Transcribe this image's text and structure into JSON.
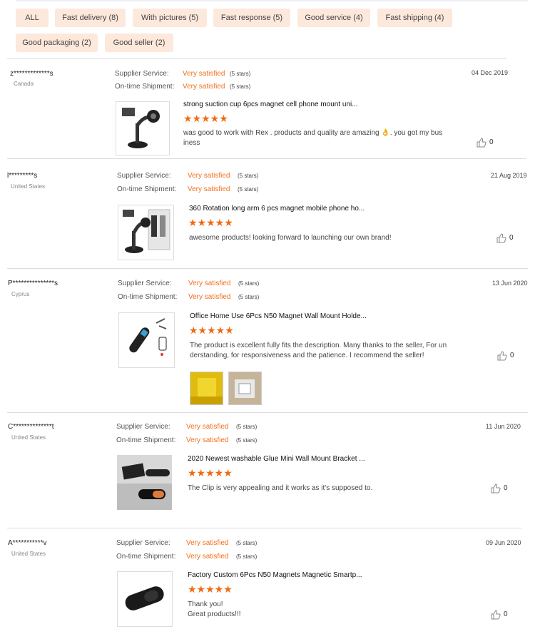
{
  "filters": [
    {
      "label": "ALL"
    },
    {
      "label": "Fast delivery (8)"
    },
    {
      "label": "With pictures (5)"
    },
    {
      "label": "Fast response (5)"
    },
    {
      "label": "Good service (4)"
    },
    {
      "label": "Fast shipping (4)"
    },
    {
      "label": "Good packaging (2)"
    },
    {
      "label": "Good seller (2)"
    }
  ],
  "labels": {
    "supplier_service": "Supplier Service:",
    "ontime_shipment": "On-time Shipment:",
    "rating_value": "Very satisfied",
    "rating_stars": "(5 stars)",
    "stars_glyphs": "★★★★★"
  },
  "colors": {
    "accent": "#f06a14",
    "chip_bg": "#fde8dc"
  },
  "reviews": [
    {
      "name": "z*************s",
      "country": "Canada",
      "date": "04 Dec 2019",
      "product": "strong suction cup 6pcs magnet cell phone mount uni...",
      "text_lines": [
        "was good to work with Rex .  products and quality are amazing 👌. you got my bus",
        "iness"
      ],
      "likes": "0",
      "thumb_icon": "phone-mount-suction-image"
    },
    {
      "name": "l*********s",
      "country": "United States",
      "date": "21 Aug 2019",
      "product": "360 Rotation long arm 6 pcs magnet mobile phone ho...",
      "text_lines": [
        "awesome products! looking forward to launching our own brand!"
      ],
      "likes": "0",
      "thumb_icon": "phone-mount-box-image"
    },
    {
      "name": "P***************s",
      "country": "Cyprus",
      "date": "13 Jun 2020",
      "product": "Office Home Use 6Pcs N50 Magnet Wall Mount Holde...",
      "text_lines": [
        "The product is excellent fully fits the description. Many thanks to the seller, For un",
        "derstanding, for responsiveness and the patience. I recommend the seller!"
      ],
      "likes": "0",
      "thumb_icon": "wall-mount-magnet-image"
    },
    {
      "name": "C**************t",
      "country": "United States",
      "date": "11 Jun 2020",
      "product": "2020 Newest washable Glue Mini Wall Mount Bracket ...",
      "text_lines": [
        "The Clip is very appealing and it works as it's supposed to."
      ],
      "likes": "0",
      "thumb_icon": "mini-wall-bracket-image"
    },
    {
      "name": "A***********v",
      "country": "United States",
      "date": "09 Jun 2020",
      "product": "Factory Custom 6Pcs N50 Magnets Magnetic Smartp...",
      "text_lines": [
        "Thank you!",
        "Great products!!!"
      ],
      "likes": "0",
      "thumb_icon": "magnetic-strip-image"
    }
  ]
}
